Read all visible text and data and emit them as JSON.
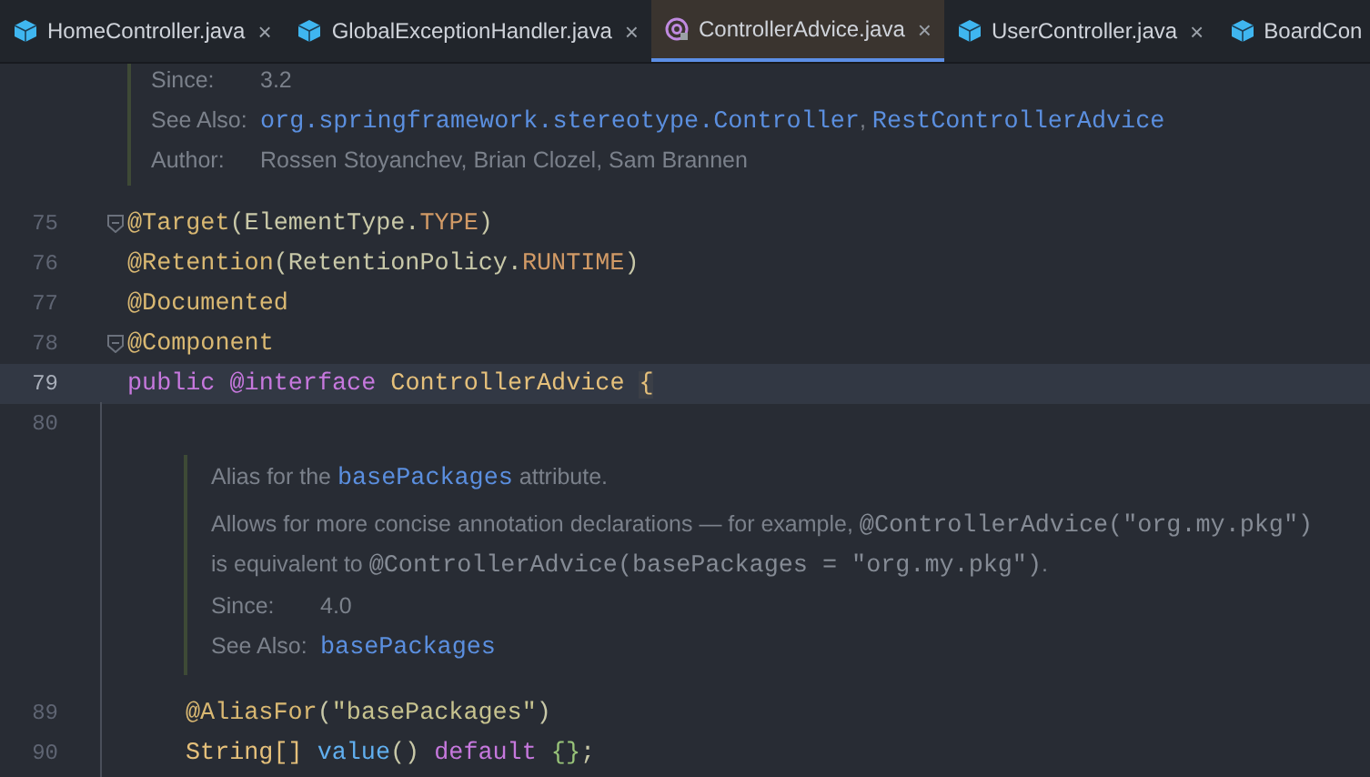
{
  "tabs": [
    {
      "kind": "class",
      "label": "HomeController.java",
      "close": "×",
      "selected": false
    },
    {
      "kind": "class",
      "label": "GlobalExceptionHandler.java",
      "close": "×",
      "selected": false
    },
    {
      "kind": "annotation",
      "label": "ControllerAdvice.java",
      "close": "×",
      "selected": true
    },
    {
      "kind": "class",
      "label": "UserController.java",
      "close": "×",
      "selected": false
    },
    {
      "kind": "class",
      "label": "BoardCon",
      "selected": false
    }
  ],
  "editor": {
    "blocks": [
      {
        "kind": "doc",
        "rows": [
          {
            "kind": "field",
            "label": "Since:",
            "value": [
              {
                "kind": "text",
                "text": "3.2"
              }
            ]
          },
          {
            "kind": "field",
            "label": "See Also:",
            "value": [
              {
                "kind": "link",
                "text": "org.springframework.stereotype.Controller"
              },
              {
                "kind": "text",
                "text": ", "
              },
              {
                "kind": "link",
                "text": "RestControllerAdvice"
              }
            ]
          },
          {
            "kind": "field",
            "label": "Author:",
            "value": [
              {
                "kind": "text",
                "text": "Rossen Stoyanchev, Brian Clozel, Sam Brannen"
              }
            ]
          }
        ]
      },
      {
        "kind": "code",
        "number": "75",
        "fold": true,
        "current": false,
        "tokens": [
          {
            "kind": "annotation",
            "text": "@Target"
          },
          {
            "kind": "plain",
            "text": "(ElementType."
          },
          {
            "kind": "constant",
            "text": "TYPE"
          },
          {
            "kind": "plain",
            "text": ")"
          }
        ]
      },
      {
        "kind": "code",
        "number": "76",
        "fold": false,
        "current": false,
        "tokens": [
          {
            "kind": "annotation",
            "text": "@Retention"
          },
          {
            "kind": "plain",
            "text": "(RetentionPolicy."
          },
          {
            "kind": "constant",
            "text": "RUNTIME"
          },
          {
            "kind": "plain",
            "text": ")"
          }
        ]
      },
      {
        "kind": "code",
        "number": "77",
        "fold": false,
        "current": false,
        "tokens": [
          {
            "kind": "annotation",
            "text": "@Documented"
          }
        ]
      },
      {
        "kind": "code",
        "number": "78",
        "fold": true,
        "current": false,
        "tokens": [
          {
            "kind": "annotation",
            "text": "@Component"
          }
        ]
      },
      {
        "kind": "code",
        "number": "79",
        "fold": false,
        "current": true,
        "tokens": [
          {
            "kind": "keyword",
            "text": "public "
          },
          {
            "kind": "keyword",
            "text": "@interface "
          },
          {
            "kind": "type",
            "text": "ControllerAdvice "
          },
          {
            "kind": "brace",
            "text": "{"
          }
        ],
        "children": [
          {
            "kind": "code",
            "number": "80",
            "fold": false,
            "current": false
          },
          {
            "kind": "doc",
            "rows": [
              {
                "kind": "paragraph",
                "value": [
                  {
                    "kind": "text",
                    "text": "Alias for the "
                  },
                  {
                    "kind": "link",
                    "text": "basePackages"
                  },
                  {
                    "kind": "text",
                    "text": " attribute."
                  }
                ]
              },
              {
                "kind": "paragraph",
                "value": [
                  {
                    "kind": "text",
                    "text": "Allows for more concise annotation declarations — for example, "
                  },
                  {
                    "kind": "code",
                    "text": "@ControllerAdvice(\"org.my.pkg\")"
                  },
                  {
                    "kind": "text",
                    "text": " is equivalent to "
                  },
                  {
                    "kind": "code",
                    "text": "@ControllerAdvice(basePackages = \"org.my.pkg\")"
                  },
                  {
                    "kind": "text",
                    "text": "."
                  }
                ]
              },
              {
                "kind": "field",
                "label": "Since:",
                "value": [
                  {
                    "kind": "text",
                    "text": "4.0"
                  }
                ]
              },
              {
                "kind": "field",
                "label": "See Also:",
                "value": [
                  {
                    "kind": "link",
                    "text": "basePackages"
                  }
                ]
              }
            ]
          },
          {
            "kind": "code",
            "number": "89",
            "fold": false,
            "current": false,
            "tokens": [
              {
                "kind": "annotation",
                "text": "@AliasFor"
              },
              {
                "kind": "plain",
                "text": "("
              },
              {
                "kind": "string",
                "text": "\"basePackages\""
              },
              {
                "kind": "plain",
                "text": ")"
              }
            ]
          },
          {
            "kind": "code",
            "number": "90",
            "fold": false,
            "current": false,
            "tokens": [
              {
                "kind": "type",
                "text": "String[] "
              },
              {
                "kind": "method",
                "text": "value"
              },
              {
                "kind": "plain",
                "text": "() "
              },
              {
                "kind": "keyword",
                "text": "default "
              },
              {
                "kind": "green",
                "text": "{}"
              },
              {
                "kind": "plain",
                "text": ";"
              }
            ]
          }
        ]
      }
    ]
  }
}
